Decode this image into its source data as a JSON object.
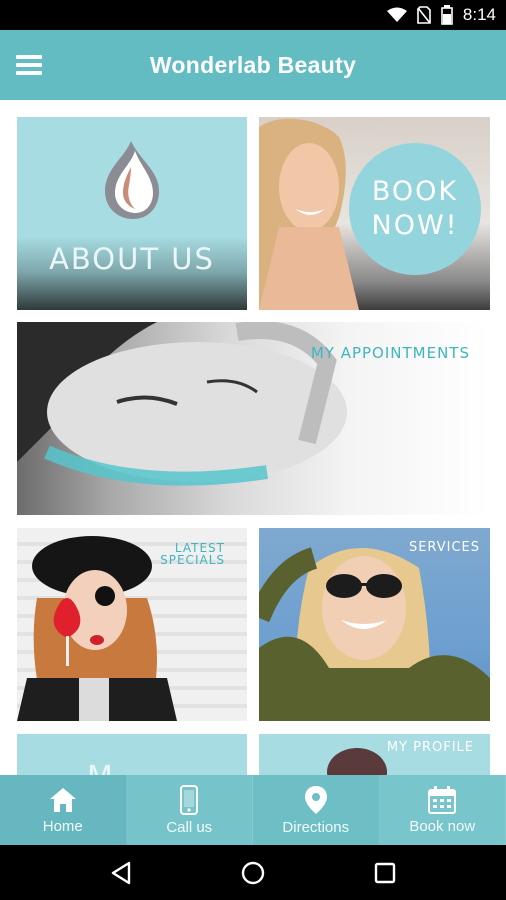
{
  "status_bar": {
    "time": "8:14",
    "icons": [
      "wifi-icon",
      "no-sim-icon",
      "battery-icon"
    ]
  },
  "app_bar": {
    "title": "Wonderlab Beauty",
    "menu_icon": "hamburger-menu-icon"
  },
  "tiles": {
    "about": {
      "label": "ABOUT US",
      "icon": "droplet-logo-icon"
    },
    "book": {
      "line1": "BOOK",
      "line2": "NOW!"
    },
    "appointments": {
      "label": "MY APPOINTMENTS"
    },
    "specials": {
      "line1": "LATEST",
      "line2": "SPECIALS"
    },
    "services": {
      "label": "SERVICES"
    },
    "profile": {
      "label": "MY PROFILE"
    },
    "more": {
      "label": "M"
    }
  },
  "bottom_nav": [
    {
      "label": "Home",
      "icon": "home-icon"
    },
    {
      "label": "Call us",
      "icon": "phone-icon"
    },
    {
      "label": "Directions",
      "icon": "location-pin-icon"
    },
    {
      "label": "Book now",
      "icon": "calendar-icon"
    }
  ],
  "colors": {
    "primary": "#63bcc2",
    "tile_light": "#a6dce2",
    "accent_text": "#3fb5bf"
  }
}
